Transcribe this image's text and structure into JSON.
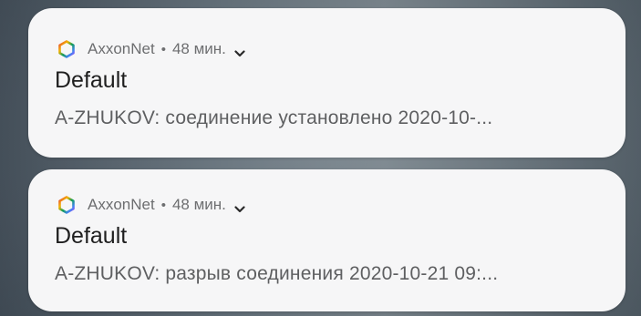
{
  "notifications": [
    {
      "app_icon": "hexagon-logo-icon",
      "app_name": "AxxonNet",
      "separator": "•",
      "time": "48 мин.",
      "expand_icon": "chevron-down-icon",
      "title": "Default",
      "body": "A-ZHUKOV: соединение установлено 2020-10-..."
    },
    {
      "app_icon": "hexagon-logo-icon",
      "app_name": "AxxonNet",
      "separator": "•",
      "time": "48 мин.",
      "expand_icon": "chevron-down-icon",
      "title": "Default",
      "body": "A-ZHUKOV: разрыв соединения 2020-10-21 09:..."
    }
  ],
  "colors": {
    "card_background": "#f6f6f7",
    "title_text": "#1f1f1f",
    "secondary_text": "#6d6e70",
    "logo_gradient": [
      "#e8453c",
      "#f4b400",
      "#0f9d58",
      "#4285f4",
      "#a142f4"
    ]
  }
}
